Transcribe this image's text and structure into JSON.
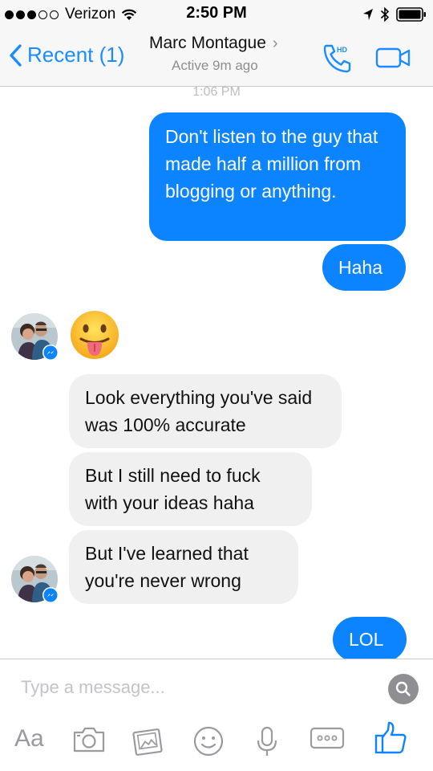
{
  "status_bar": {
    "carrier": "Verizon",
    "time": "2:50 PM",
    "signal_bars_filled": 3,
    "signal_bars_total": 5
  },
  "nav": {
    "back_label": "Recent (1)",
    "contact_name": "Marc Montague",
    "status": "Active 9m ago",
    "call_badge": "HD"
  },
  "conversation": {
    "timestamp": "1:06 PM",
    "messages": [
      {
        "direction": "outgoing",
        "text": "Don't listen to the guy that made half a million from blogging or anything."
      },
      {
        "direction": "outgoing",
        "text": "Haha"
      },
      {
        "direction": "incoming",
        "text": "",
        "emoji": "face-with-tongue"
      },
      {
        "direction": "incoming",
        "text": "Look everything you've said was 100% accurate"
      },
      {
        "direction": "incoming",
        "text": "But I still need to fuck with your ideas haha"
      },
      {
        "direction": "incoming",
        "text": "But I've learned that you're never wrong"
      },
      {
        "direction": "outgoing",
        "text": "LOL"
      }
    ]
  },
  "composer": {
    "placeholder": "Type a message...",
    "text_tool_label": "Aa",
    "tools": [
      "text-icon",
      "camera-icon",
      "photo-icon",
      "sticker-icon",
      "microphone-icon",
      "more-icon",
      "like-icon"
    ]
  },
  "colors": {
    "accent": "#1a8cff",
    "outgoing_bubble": "#0d84ff",
    "incoming_bubble": "#f0f0f0",
    "secondary_text": "#8e8e93"
  }
}
